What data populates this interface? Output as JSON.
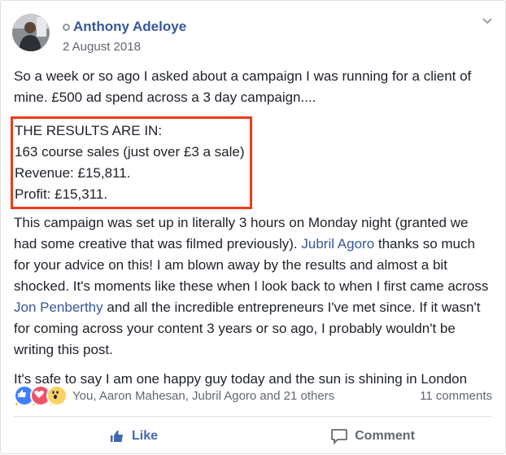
{
  "post": {
    "author": "Anthony Adeloye",
    "date": "2 August 2018",
    "intro": "So a week or so ago I asked about a campaign I was running for a client of mine. £500 ad spend across a 3 day campaign....",
    "results": {
      "line1": "THE RESULTS ARE IN:",
      "line2": "163 course sales (just over £3 a sale)",
      "line3": "Revenue: £15,811.",
      "line4": "Profit: £15,311."
    },
    "para2": {
      "part1": "This campaign was set up in literally 3 hours on Monday night (granted we had some creative that was filmed previously). ",
      "mention1": "Jubril Agoro",
      "part2": " thanks so much for your advice on this! I am blown away by the results and almost a bit shocked. It's moments like these when I look back to when I first came across ",
      "mention2": "Jon Penberthy",
      "part3": " and all the incredible entrepreneurs I've met since. If it wasn't for coming across your content 3 years or so ago, I probably wouldn't be writing this post."
    },
    "para3": "It's safe to say I am one happy guy today and the sun is shining in London",
    "emoji_name": "party-popper-icon"
  },
  "reactions": {
    "summary": "You, Aaron Mahesan, Jubril Agoro and 21 others",
    "comments": "11 comments"
  },
  "actions": {
    "like": "Like",
    "comment": "Comment"
  },
  "colors": {
    "link": "#365899",
    "highlight_border": "#f03a17",
    "like_blue": "#4267b2"
  }
}
